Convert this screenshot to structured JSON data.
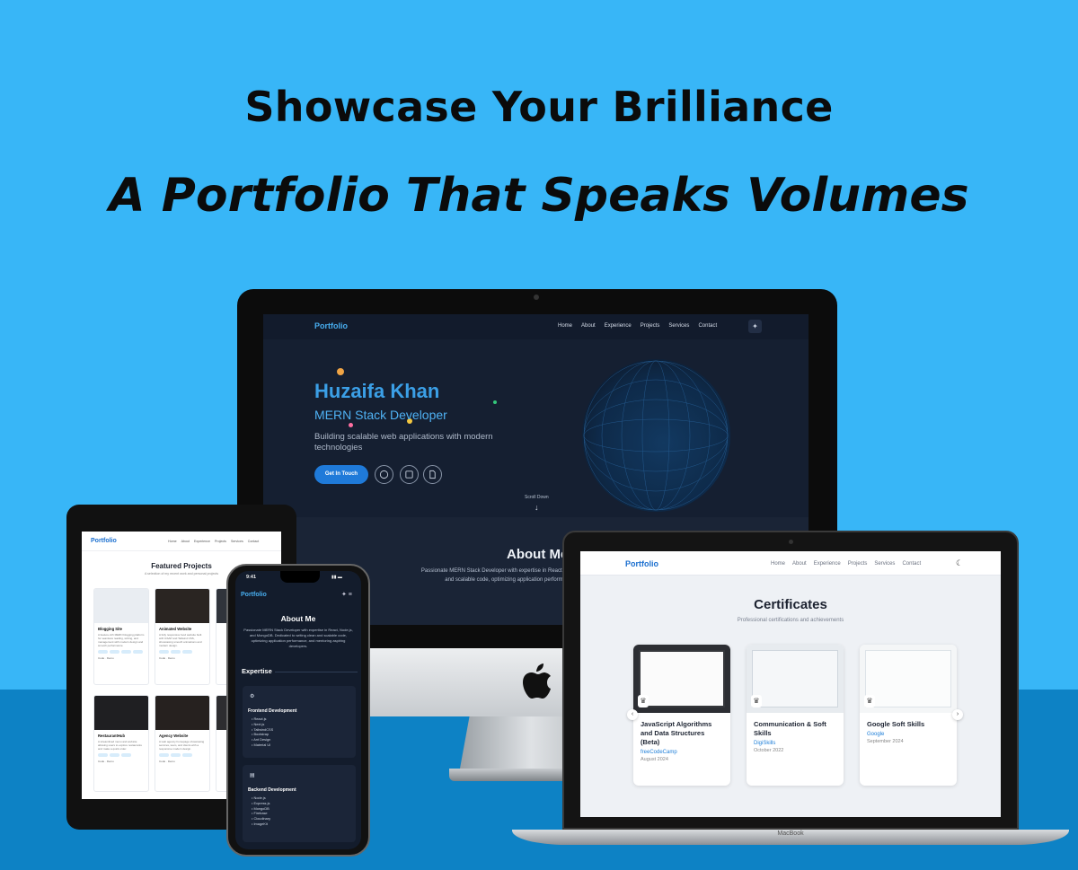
{
  "headline": "Showcase Your Brilliance",
  "subheadline": "A Portfolio That Speaks Volumes",
  "desktop": {
    "logo": "Portfolio",
    "nav": [
      "Home",
      "About",
      "Experience",
      "Projects",
      "Services",
      "Contact"
    ],
    "hero_name": "Huzaifa Khan",
    "hero_role": "MERN Stack Developer",
    "hero_desc": "Building scalable web applications with modern technologies",
    "cta": "Get In Touch",
    "scroll": "Scroll Down",
    "about_title": "About Me",
    "about_text": "Passionate MERN Stack Developer with expertise in React, Node.js, and MongoDB. Dedicated to writing clean and scalable code, optimizing application performance, and mentoring aspiring developers."
  },
  "tablet": {
    "logo": "Portfolio",
    "nav": [
      "Home",
      "About",
      "Experience",
      "Projects",
      "Services",
      "Contact"
    ],
    "section_title": "Featured Projects",
    "section_sub": "A selection of my recent work and personal projects",
    "projects": [
      {
        "title": "Blogging Site",
        "desc": "A feature-rich MERN blogging platform for seamless reading, writing, and management with modern design and smooth performance."
      },
      {
        "title": "Animated Website",
        "desc": "A fully responsive food website built with GSAP and Tailwind CSS, showcasing smooth animations and modern design."
      },
      {
        "title": "RestaurantHub",
        "desc": "A streamlined menu and website allowing users to explore restaurants and make a quick order."
      },
      {
        "title": "Agency Website",
        "desc": "A web agency homepage showcasing services, team, and clients with a responsive modern design."
      }
    ],
    "code_label": "Code",
    "demo_label": "Demo"
  },
  "phone": {
    "time": "9:41",
    "logo": "Portfolio",
    "about_title": "About Me",
    "about_text": "Passionate MERN Stack Developer with expertise in React, Node.js, and MongoDB. Dedicated to writing clean and scalable code, optimizing application performance, and mentoring aspiring developers.",
    "section": "Expertise",
    "frontend_title": "Frontend Development",
    "frontend": [
      "React.js",
      "Next.js",
      "TailwindCSS",
      "Bootstrap",
      "Ant Design",
      "Material UI"
    ],
    "backend_title": "Backend Development",
    "backend": [
      "Node.js",
      "Express.js",
      "MongoDB",
      "Firebase",
      "Cloudinary",
      "ImageKit"
    ]
  },
  "laptop": {
    "logo": "Portfolio",
    "nav": [
      "Home",
      "About",
      "Experience",
      "Projects",
      "Services",
      "Contact"
    ],
    "title": "Certificates",
    "subtitle": "Professional certifications and achievements",
    "certs": [
      {
        "title": "JavaScript Algorithms and Data Structures (Beta)",
        "issuer": "freeCodeCamp",
        "date": "August 2024"
      },
      {
        "title": "Communication & Soft Skills",
        "issuer": "DigiSkills",
        "date": "October 2022"
      },
      {
        "title": "Google Soft Skills",
        "issuer": "Google",
        "date": "September 2024"
      }
    ],
    "brand": "MacBook"
  },
  "colors": {
    "background": "#38b6f7",
    "floor": "#0d82c5",
    "accent": "#1b6fcf"
  }
}
